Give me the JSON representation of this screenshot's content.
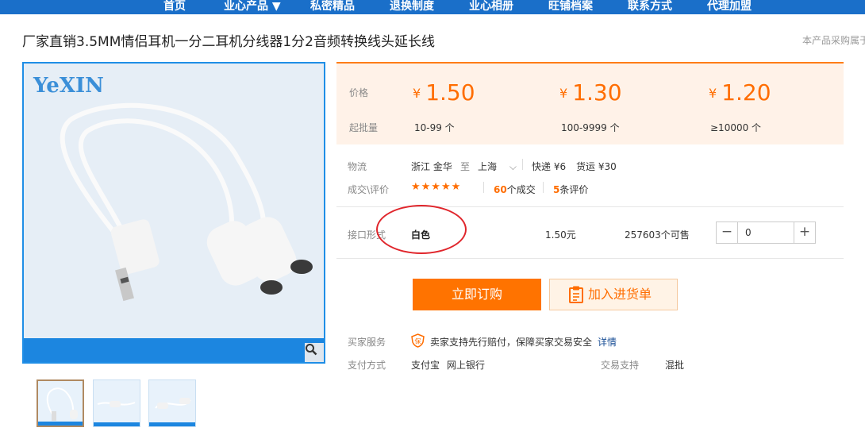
{
  "nav": {
    "items": [
      "首页",
      "业心产品 ▼",
      "私密精品",
      "退换制度",
      "业心相册",
      "旺铺档案",
      "联系方式",
      "代理加盟"
    ]
  },
  "product": {
    "title": "厂家直销3.5MM情侣耳机一分二耳机分线器1分2音频转换线头延长线",
    "purchase_note": "本产品采购属于"
  },
  "gallery": {
    "logo_text": "YeXIN",
    "zoom_icon": "magnifier-icon",
    "thumbnails": [
      "thumb-1",
      "thumb-2",
      "thumb-3"
    ]
  },
  "pricing": {
    "price_label": "价格",
    "moq_label": "起批量",
    "currency": "¥",
    "tiers": [
      {
        "price": "1.50",
        "range": "10-99 个"
      },
      {
        "price": "1.30",
        "range": "100-9999 个"
      },
      {
        "price": "1.20",
        "range": "≥10000 个"
      }
    ]
  },
  "logistics": {
    "label": "物流",
    "origin": "浙江 金华",
    "to": "至",
    "destination": "上海",
    "express": "快递 ¥6",
    "freight": "货运 ¥30"
  },
  "reviews": {
    "label": "成交\\评价",
    "stars": "★★★★★",
    "deals_count": "60",
    "deals_suffix": "个成交",
    "review_count": "5",
    "review_suffix": "条评价"
  },
  "sku": {
    "label": "接口形式",
    "option": "白色",
    "price": "1.50元",
    "stock": "257603个可售",
    "quantity": "0"
  },
  "actions": {
    "buy": "立即订购",
    "cart": "加入进货单"
  },
  "service": {
    "buyer_label": "买家服务",
    "buyer_text": "卖家支持先行赔付，保障买家交易安全",
    "details_link": "详情",
    "payment_label": "支付方式",
    "payment_methods": [
      "支付宝",
      "网上银行"
    ],
    "trade_label": "交易支持",
    "trade_value": "混批"
  },
  "colors": {
    "nav_bg": "#1a6fc9",
    "accent": "#ff6d00",
    "annotation": "#e0252b"
  }
}
